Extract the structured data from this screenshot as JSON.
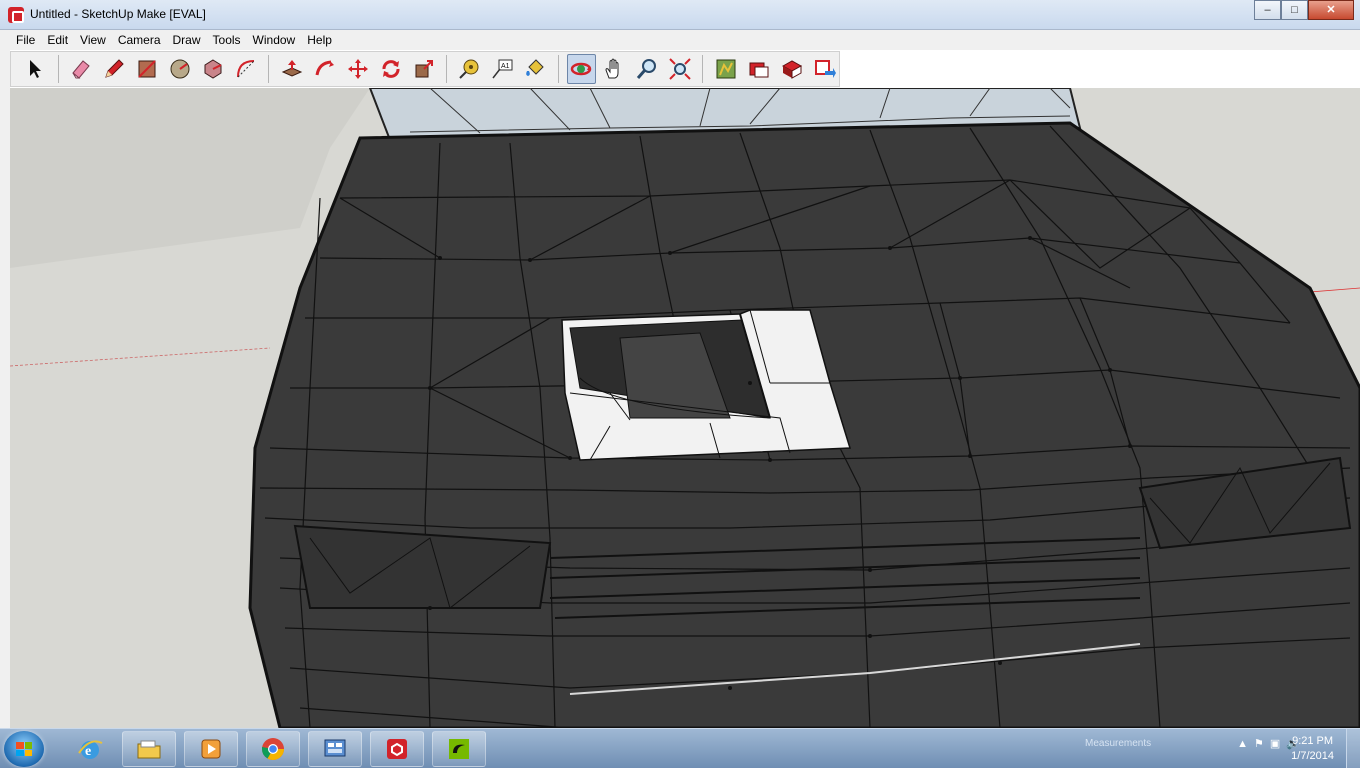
{
  "window": {
    "title": "Untitled - SketchUp Make [EVAL]",
    "minimize": "‒",
    "maximize": "□",
    "close": "✕"
  },
  "menu": [
    "File",
    "Edit",
    "View",
    "Camera",
    "Draw",
    "Tools",
    "Window",
    "Help"
  ],
  "toolbar": {
    "tools": [
      {
        "name": "select",
        "icon": "select-arrow-icon"
      },
      {
        "name": "eraser",
        "icon": "eraser-icon"
      },
      {
        "name": "line",
        "icon": "pencil-icon"
      },
      {
        "name": "rectangle",
        "icon": "rectangle-icon"
      },
      {
        "name": "circle",
        "icon": "circle-icon"
      },
      {
        "name": "polygon",
        "icon": "polygon-icon"
      },
      {
        "name": "arc",
        "icon": "arc-icon"
      },
      {
        "name": "push-pull",
        "icon": "push-pull-icon"
      },
      {
        "name": "follow-me",
        "icon": "follow-me-icon"
      },
      {
        "name": "move",
        "icon": "move-icon"
      },
      {
        "name": "rotate",
        "icon": "rotate-icon"
      },
      {
        "name": "scale",
        "icon": "scale-icon"
      },
      {
        "name": "tape-measure",
        "icon": "tape-measure-icon"
      },
      {
        "name": "text",
        "icon": "text-icon"
      },
      {
        "name": "paint-bucket",
        "icon": "paint-bucket-icon"
      },
      {
        "name": "orbit",
        "icon": "orbit-icon"
      },
      {
        "name": "pan",
        "icon": "pan-hand-icon"
      },
      {
        "name": "zoom",
        "icon": "zoom-icon"
      },
      {
        "name": "zoom-extents",
        "icon": "zoom-extents-icon"
      },
      {
        "name": "3d-warehouse",
        "icon": "warehouse-icon"
      },
      {
        "name": "extension-warehouse",
        "icon": "extension-icon"
      },
      {
        "name": "get-models",
        "icon": "get-models-icon"
      },
      {
        "name": "share-model",
        "icon": "share-model-icon"
      }
    ],
    "active_tool": "orbit"
  },
  "taskbar": {
    "apps": [
      {
        "name": "internet-explorer",
        "icon": "ie-icon"
      },
      {
        "name": "file-explorer",
        "icon": "folder-icon"
      },
      {
        "name": "media-player",
        "icon": "media-player-icon"
      },
      {
        "name": "chrome",
        "icon": "chrome-icon"
      },
      {
        "name": "control-panel",
        "icon": "control-panel-icon"
      },
      {
        "name": "sketchup",
        "icon": "sketchup-icon"
      },
      {
        "name": "nvidia",
        "icon": "nvidia-icon"
      }
    ],
    "time": "9:21 PM",
    "date": "1/7/2014",
    "tray_label": "Measurements"
  },
  "colors": {
    "accent": "#d2232a",
    "model": "#3b3b3b",
    "ground": "#d8d8d3",
    "sky": "#c9d3db"
  }
}
